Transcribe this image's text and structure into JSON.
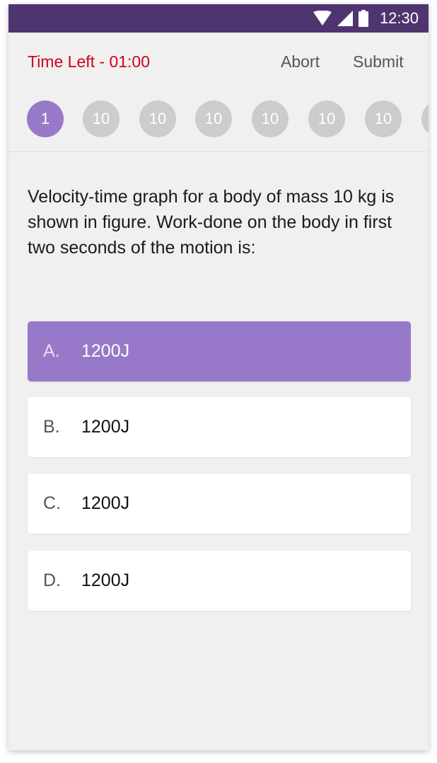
{
  "status_bar": {
    "time": "12:30",
    "icons": [
      "wifi-icon",
      "signal-icon",
      "battery-icon"
    ]
  },
  "header": {
    "time_left": "Time Left - 01:00",
    "abort_label": "Abort",
    "submit_label": "Submit"
  },
  "question_nav": [
    {
      "label": "1",
      "active": true
    },
    {
      "label": "10",
      "active": false
    },
    {
      "label": "10",
      "active": false
    },
    {
      "label": "10",
      "active": false
    },
    {
      "label": "10",
      "active": false
    },
    {
      "label": "10",
      "active": false
    },
    {
      "label": "10",
      "active": false
    },
    {
      "label": "",
      "active": false
    }
  ],
  "question": {
    "text": "Velocity-time graph for a body of mass 10 kg is shown in figure. Work-done on the body in first two seconds of the motion is:"
  },
  "options": [
    {
      "letter": "A.",
      "text": "1200J",
      "selected": true
    },
    {
      "letter": "B.",
      "text": "1200J",
      "selected": false
    },
    {
      "letter": "C.",
      "text": "1200J",
      "selected": false
    },
    {
      "letter": "D.",
      "text": "1200J",
      "selected": false
    }
  ],
  "colors": {
    "status_bar": "#4f3570",
    "accent": "#9879c9",
    "time_left": "#d0021b",
    "inactive_dot": "#cccccc",
    "background": "#f0f0f0"
  }
}
